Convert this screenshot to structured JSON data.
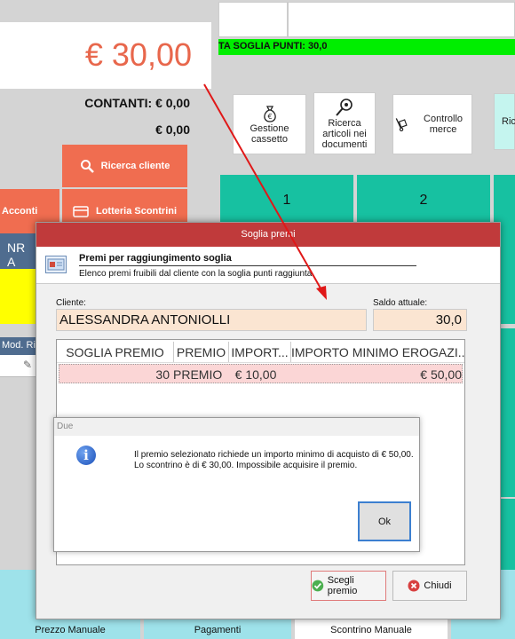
{
  "pos": {
    "amount": "€ 30,00",
    "cash": "CONTANTI: € 0,00",
    "change": "€ 0,00",
    "search_customer": "Ricerca cliente",
    "acconti": "Acconti",
    "lottery": "Lotteria Scontrini",
    "nr": "NR A",
    "mod_header": "Mod. Ri",
    "threshold_banner": "TA SOGLIA PUNTI: 30,0",
    "tile_cash": "Gestione cassetto",
    "tile_search_docs": "Ricerca articoli nei documenti",
    "tile_goods": "Controllo merce",
    "tile_ric": "Ric",
    "key_1": "1",
    "key_2": "2",
    "bottom_1": "Prezzo Manuale",
    "bottom_2": "Pagamenti",
    "bottom_3": "Scontrino Manuale"
  },
  "dialog": {
    "title": "Soglia premi",
    "header_title": "Premi per raggiungimento soglia",
    "header_subtitle": "Elenco premi fruibili dal cliente con la soglia punti raggiunta",
    "customer_label": "Cliente:",
    "customer_value": "ALESSANDRA ANTONIOLLI",
    "balance_label": "Saldo attuale:",
    "balance_value": "30,0",
    "columns": [
      "SOGLIA PREMIO",
      "PREMIO",
      "IMPORT...",
      "IMPORTO MINIMO EROGAZI..."
    ],
    "row": {
      "threshold": "30",
      "prize": "PREMIO",
      "amount": "€ 10,00",
      "min_amount": "€ 50,00"
    },
    "choose_label": "Scegli premio",
    "close_label": "Chiudi"
  },
  "message": {
    "title": "Due",
    "line1": "Il premio selezionato richiede un importo minimo di acquisto di € 50,00.",
    "line2": "Lo scontrino è di € 30,00. Impossibile acquisire il premio.",
    "ok_label": "Ok"
  },
  "colors": {
    "accent_orange": "#f06d50",
    "amount_orange": "#e8674c",
    "teal": "#17c1a1",
    "title_red": "#c03a3b",
    "green_banner": "#00ee00"
  }
}
